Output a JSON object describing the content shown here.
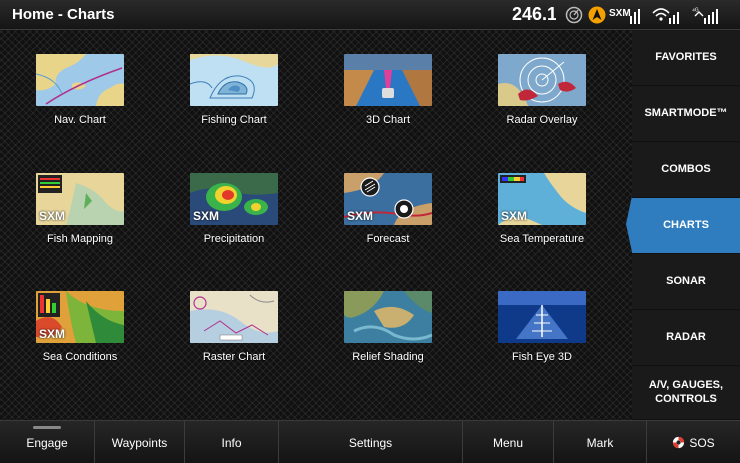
{
  "topbar": {
    "title": "Home - Charts",
    "heading_value": "246.1$",
    "sxm_label": "SXM",
    "colors": {
      "gps_icon": "#f4a000"
    }
  },
  "tiles": [
    {
      "label": "Nav. Chart",
      "sxm": ""
    },
    {
      "label": "Fishing Chart",
      "sxm": ""
    },
    {
      "label": "3D Chart",
      "sxm": ""
    },
    {
      "label": "Radar Overlay",
      "sxm": ""
    },
    {
      "label": "Fish Mapping",
      "sxm": "SXM"
    },
    {
      "label": "Precipitation",
      "sxm": "SXM"
    },
    {
      "label": "Forecast",
      "sxm": "SXM"
    },
    {
      "label": "Sea Temperature",
      "sxm": "SXM"
    },
    {
      "label": "Sea Conditions",
      "sxm": "SXM"
    },
    {
      "label": "Raster Chart",
      "sxm": ""
    },
    {
      "label": "Relief Shading",
      "sxm": ""
    },
    {
      "label": "Fish Eye 3D",
      "sxm": ""
    }
  ],
  "sidebar": {
    "items": [
      {
        "label": "FAVORITES"
      },
      {
        "label": "SMARTMODE™"
      },
      {
        "label": "COMBOS"
      },
      {
        "label": "CHARTS",
        "active": true
      },
      {
        "label": "SONAR"
      },
      {
        "label": "RADAR"
      },
      {
        "label": "A/V, GAUGES, CONTROLS"
      }
    ],
    "active_color": "#2f7dbf"
  },
  "bottombar": {
    "engage": "Engage",
    "waypoints": "Waypoints",
    "info": "Info",
    "settings": "Settings",
    "menu": "Menu",
    "mark": "Mark",
    "sos": "SOS",
    "sos_color": "#e23b2e"
  }
}
